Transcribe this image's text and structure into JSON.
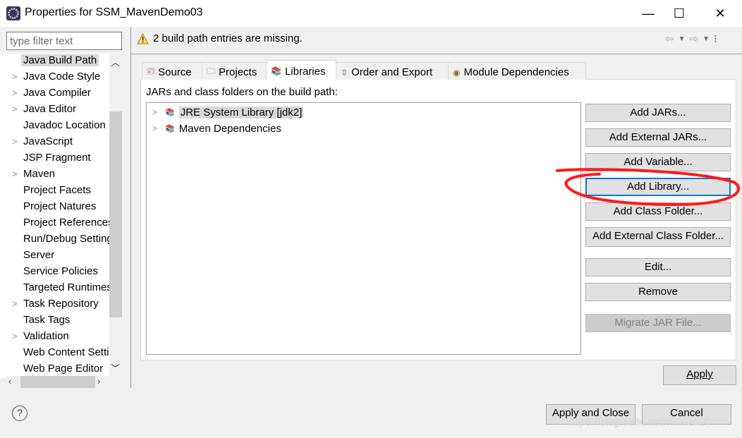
{
  "window": {
    "title": "Properties for SSM_MavenDemo03",
    "minimize": "—",
    "maximize": "☐",
    "close": "✕"
  },
  "filter": {
    "placeholder": "type filter text"
  },
  "tree": [
    {
      "label": "Java Build Path",
      "expandable": false,
      "selected": true
    },
    {
      "label": "Java Code Style",
      "expandable": true
    },
    {
      "label": "Java Compiler",
      "expandable": true
    },
    {
      "label": "Java Editor",
      "expandable": true
    },
    {
      "label": "Javadoc Location",
      "expandable": false
    },
    {
      "label": "JavaScript",
      "expandable": true
    },
    {
      "label": "JSP Fragment",
      "expandable": false
    },
    {
      "label": "Maven",
      "expandable": true
    },
    {
      "label": "Project Facets",
      "expandable": false
    },
    {
      "label": "Project Natures",
      "expandable": false
    },
    {
      "label": "Project References",
      "expandable": false
    },
    {
      "label": "Run/Debug Settings",
      "expandable": false
    },
    {
      "label": "Server",
      "expandable": false
    },
    {
      "label": "Service Policies",
      "expandable": false
    },
    {
      "label": "Targeted Runtimes",
      "expandable": false
    },
    {
      "label": "Task Repository",
      "expandable": true
    },
    {
      "label": "Task Tags",
      "expandable": false
    },
    {
      "label": "Validation",
      "expandable": true
    },
    {
      "label": "Web Content Settings",
      "expandable": false
    },
    {
      "label": "Web Page Editor",
      "expandable": false
    }
  ],
  "warning": {
    "icon": "warning-icon",
    "text": "2 build path entries are missing."
  },
  "tabs": [
    {
      "label": "Source",
      "icon": "source-icon"
    },
    {
      "label": "Projects",
      "icon": "folder-icon"
    },
    {
      "label": "Libraries",
      "icon": "library-icon",
      "active": true
    },
    {
      "label": "Order and Export",
      "icon": "order-icon"
    },
    {
      "label": "Module Dependencies",
      "icon": "module-icon"
    }
  ],
  "panel_label": "JARs and class folders on the build path:",
  "entries": [
    {
      "label": "JRE System Library [jdk2]",
      "selected": true
    },
    {
      "label": "Maven Dependencies"
    }
  ],
  "buttons": [
    "Add JARs...",
    "Add External JARs...",
    "Add Variable...",
    "Add Library...",
    "Add Class Folder...",
    "Add External Class Folder...",
    "Edit...",
    "Remove",
    "Migrate JAR File..."
  ],
  "apply": "Apply",
  "apply_close": "Apply and Close",
  "cancel": "Cancel",
  "help": "?",
  "watermark": "https://blog.csdn.net/sfchl2020",
  "annotation_color": "#ff1a1a"
}
